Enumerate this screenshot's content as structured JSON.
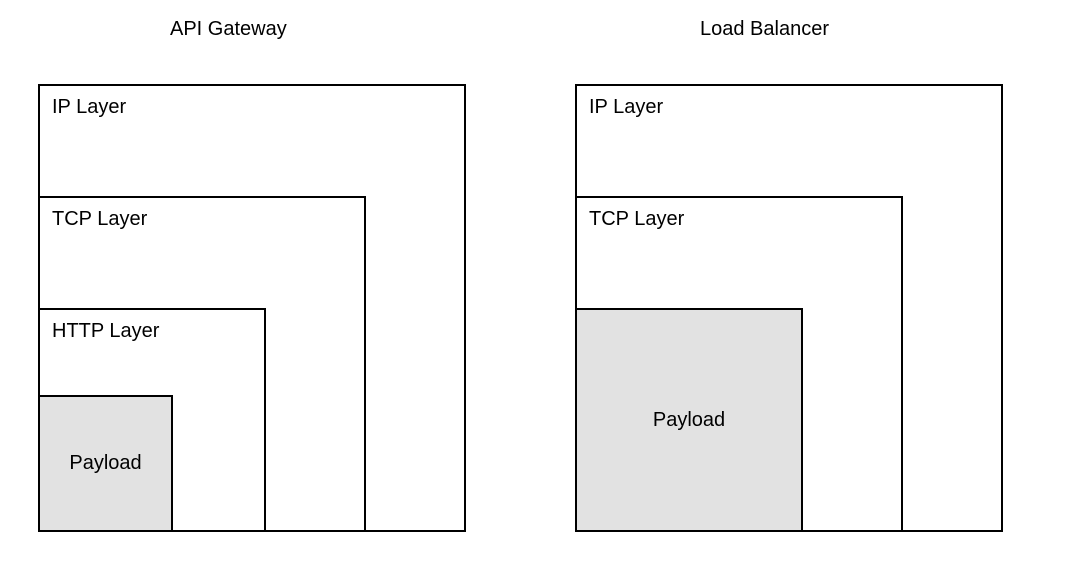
{
  "left": {
    "title": "API Gateway",
    "layers": {
      "ip": "IP Layer",
      "tcp": "TCP Layer",
      "http": "HTTP Layer",
      "payload": "Payload"
    }
  },
  "right": {
    "title": "Load Balancer",
    "layers": {
      "ip": "IP Layer",
      "tcp": "TCP Layer",
      "payload": "Payload"
    }
  }
}
